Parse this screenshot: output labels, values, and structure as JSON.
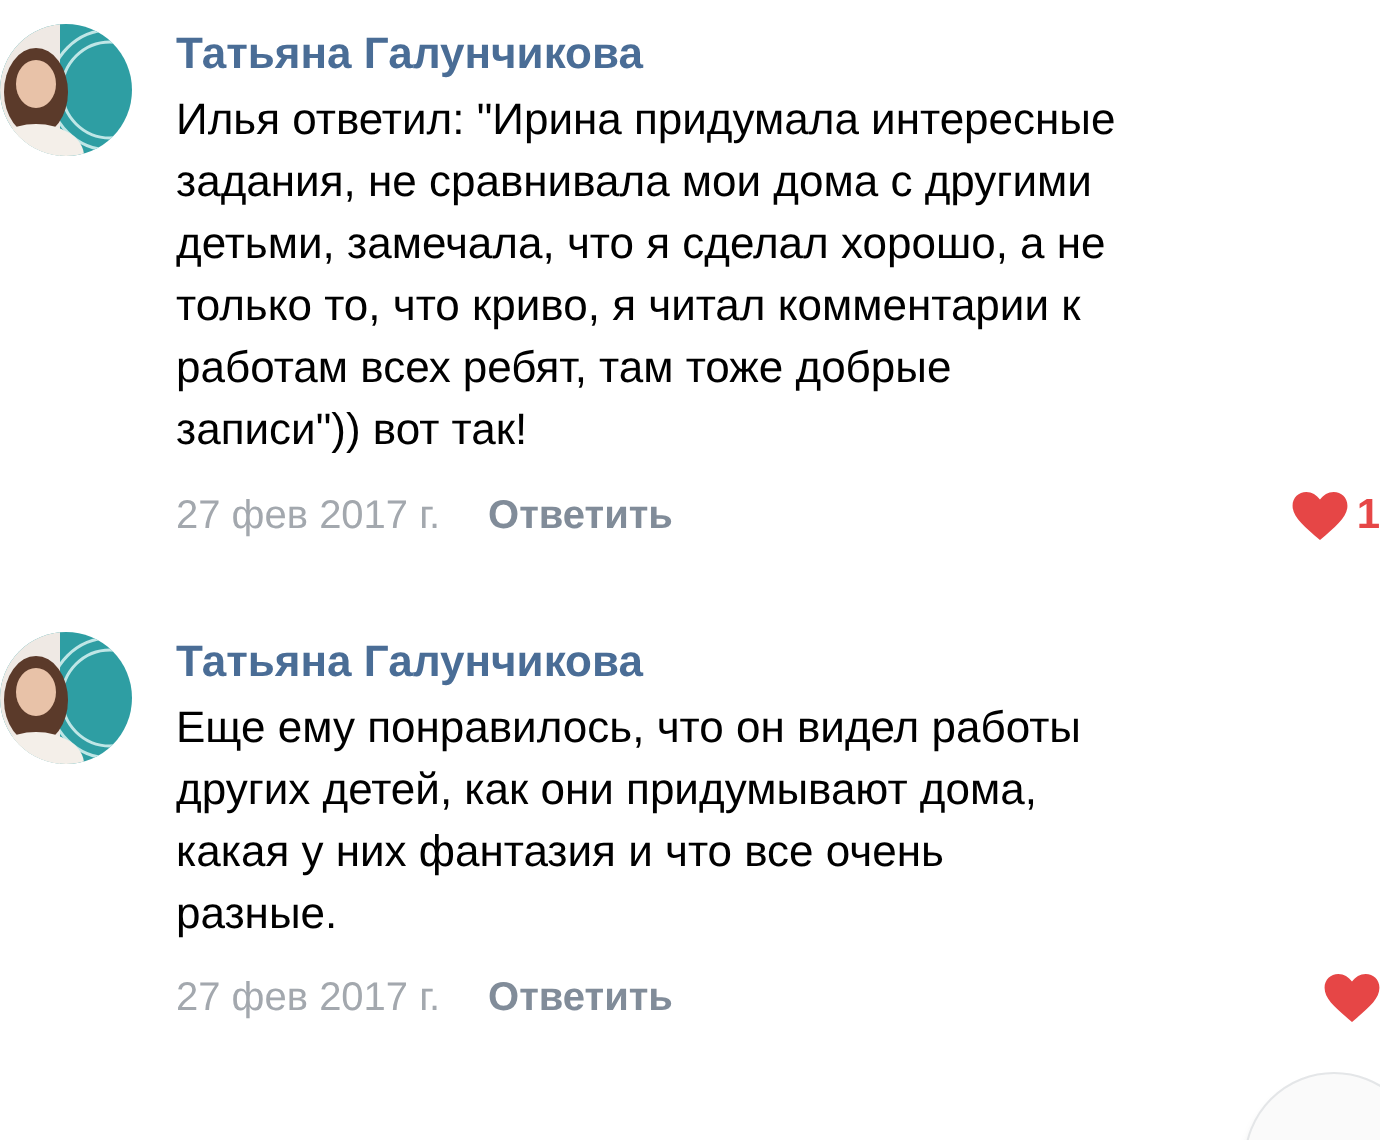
{
  "comments": [
    {
      "author": "Татьяна Галунчикова",
      "text": "Илья ответил: \"Ирина придумала интересные задания, не сравнивала мои дома с другими детьми, замечала, что я сделал хорошо, а не только то, что криво, я читал комментарии к работам всех ребят, там тоже добрые записи\")) вот так!",
      "date": "27 фев 2017 г.",
      "reply": "Ответить",
      "liked": true,
      "likes": "1"
    },
    {
      "author": "Татьяна Галунчикова",
      "text": "Еще ему понравилось, что он видел работы других детей, как они придумывают дома, какая у них фантазия и что все очень разные.",
      "date": "27 фев 2017 г.",
      "reply": "Ответить",
      "liked": true
    }
  ]
}
